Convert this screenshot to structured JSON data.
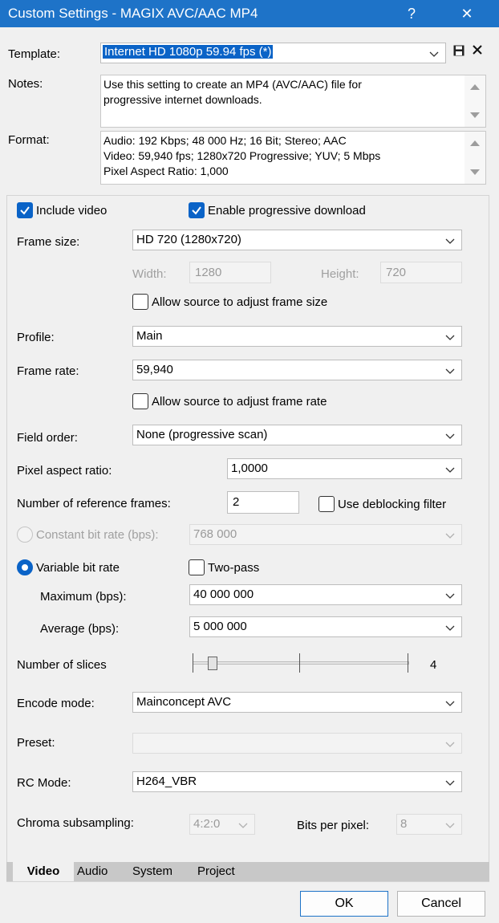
{
  "window": {
    "title": "Custom Settings - MAGIX AVC/AAC MP4",
    "help_glyph": "?",
    "close_glyph": "✕"
  },
  "template": {
    "label": "Template:",
    "value": "Internet HD 1080p 59.94 fps (*)"
  },
  "notes": {
    "label": "Notes:",
    "lines": [
      "Use this setting to create an MP4 (AVC/AAC) file for",
      "progressive internet downloads."
    ]
  },
  "format": {
    "label": "Format:",
    "lines": [
      "Audio: 192 Kbps; 48 000 Hz; 16 Bit; Stereo; AAC",
      "Video: 59,940 fps; 1280x720 Progressive; YUV; 5 Mbps",
      "Pixel Aspect Ratio: 1,000"
    ]
  },
  "video": {
    "include_video": {
      "label": "Include video",
      "checked": true
    },
    "progressive_download": {
      "label": "Enable progressive download",
      "checked": true
    },
    "frame_size": {
      "label": "Frame size:",
      "value": "HD 720 (1280x720)"
    },
    "width": {
      "label": "Width:",
      "value": "1280"
    },
    "height": {
      "label": "Height:",
      "value": "720"
    },
    "allow_frame_size": {
      "label": "Allow source to adjust frame size",
      "checked": false
    },
    "profile": {
      "label": "Profile:",
      "value": "Main"
    },
    "frame_rate": {
      "label": "Frame rate:",
      "value": "59,940"
    },
    "allow_frame_rate": {
      "label": "Allow source to adjust frame rate",
      "checked": false
    },
    "field_order": {
      "label": "Field order:",
      "value": "None (progressive scan)"
    },
    "pixel_aspect": {
      "label": "Pixel aspect ratio:",
      "value": "1,0000"
    },
    "ref_frames": {
      "label": "Number of reference frames:",
      "value": "2"
    },
    "deblocking": {
      "label": "Use deblocking filter",
      "checked": false
    },
    "cbr": {
      "label": "Constant bit rate (bps):",
      "value": "768 000",
      "selected": false
    },
    "vbr": {
      "label": "Variable bit rate",
      "selected": true
    },
    "two_pass": {
      "label": "Two-pass",
      "checked": false
    },
    "maximum": {
      "label": "Maximum (bps):",
      "value": "40 000 000"
    },
    "average": {
      "label": "Average (bps):",
      "value": "5 000 000"
    },
    "slices": {
      "label": "Number of slices",
      "value": "4",
      "min": 1,
      "max": 16
    },
    "encode_mode": {
      "label": "Encode mode:",
      "value": "Mainconcept AVC"
    },
    "preset": {
      "label": "Preset:",
      "value": ""
    },
    "rc_mode": {
      "label": "RC Mode:",
      "value": "H264_VBR"
    },
    "chroma": {
      "label": "Chroma subsampling:",
      "value": "4:2:0"
    },
    "bpp": {
      "label": "Bits per pixel:",
      "value": "8"
    }
  },
  "tabs": [
    "Video",
    "Audio",
    "System",
    "Project"
  ],
  "active_tab": "Video",
  "buttons": {
    "ok": "OK",
    "cancel": "Cancel"
  },
  "colors": {
    "title_bar": "#1e73c8",
    "accent": "#0a63c7"
  }
}
